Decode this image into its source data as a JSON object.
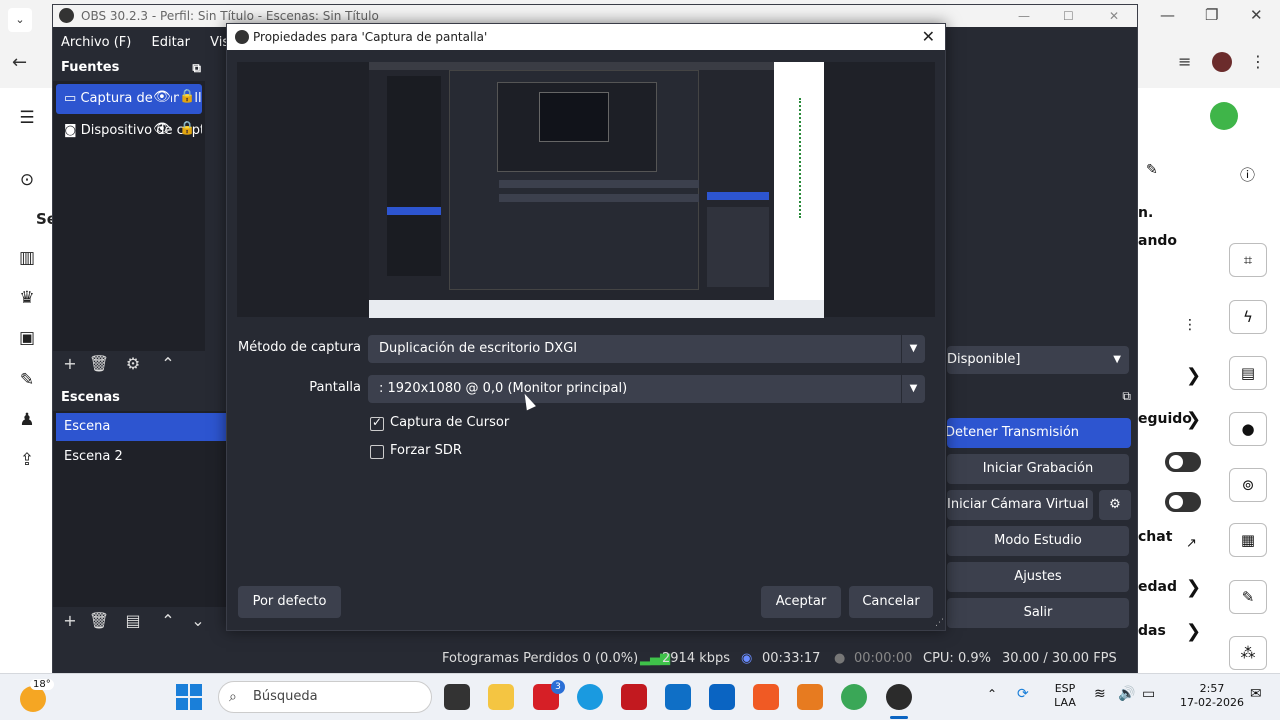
{
  "obs": {
    "title": "OBS 30.2.3 - Perfil: Sin Título - Escenas: Sin Título",
    "menu": [
      "Archivo (F)",
      "Editar",
      "Vista"
    ],
    "sources_header": "Fuentes",
    "sources": [
      {
        "label": "Captura de pantalla"
      },
      {
        "label": "Dispositivo de captura de video"
      }
    ],
    "scenes_header": "Escenas",
    "scenes": [
      {
        "label": "Escena",
        "selected": true
      },
      {
        "label": "Escena 2",
        "selected": false
      }
    ],
    "controls": {
      "stop_stream": "Detener Transmisión",
      "start_record": "Iniciar Grabación",
      "virtual_cam": "Iniciar Cámara Virtual",
      "studio_mode": "Modo Estudio",
      "settings": "Ajustes",
      "exit": "Salir",
      "audio_combo": "Disponible]"
    },
    "status": {
      "dropped_frames": "Fotogramas Perdidos 0 (0.0%)",
      "bitrate": "2914 kbps",
      "stream_time": "00:33:17",
      "record_time": "00:00:00",
      "cpu": "CPU: 0.9%",
      "fps": "30.00 / 30.00 FPS"
    }
  },
  "dialog": {
    "title": "Propiedades para 'Captura de pantalla'",
    "capture_method_label": "Método de captura",
    "capture_method_value": "Duplicación de escritorio DXGI",
    "display_label": "Pantalla",
    "display_value": ": 1920x1080 @ 0,0 (Monitor principal)",
    "capture_cursor_label": "Captura de Cursor",
    "capture_cursor_checked": true,
    "force_sdr_label": "Forzar SDR",
    "force_sdr_checked": false,
    "defaults_button": "Por defecto",
    "ok_button": "Aceptar",
    "cancel_button": "Cancelar"
  },
  "background_page": {
    "left_text": "Se",
    "right_texts": [
      "n.",
      "ando",
      "eguido",
      "chat",
      "edad",
      "das"
    ]
  },
  "taskbar": {
    "weather_temp": "18°",
    "search_placeholder": "Búsqueda",
    "mail_badge": "3",
    "lang": "ESP",
    "layout": "LAA",
    "time": "2:57",
    "date": "17-02-2026"
  },
  "colors": {
    "obs_bg": "#272a33",
    "obs_accent": "#2d55d0",
    "button_bg": "#3c404d"
  }
}
